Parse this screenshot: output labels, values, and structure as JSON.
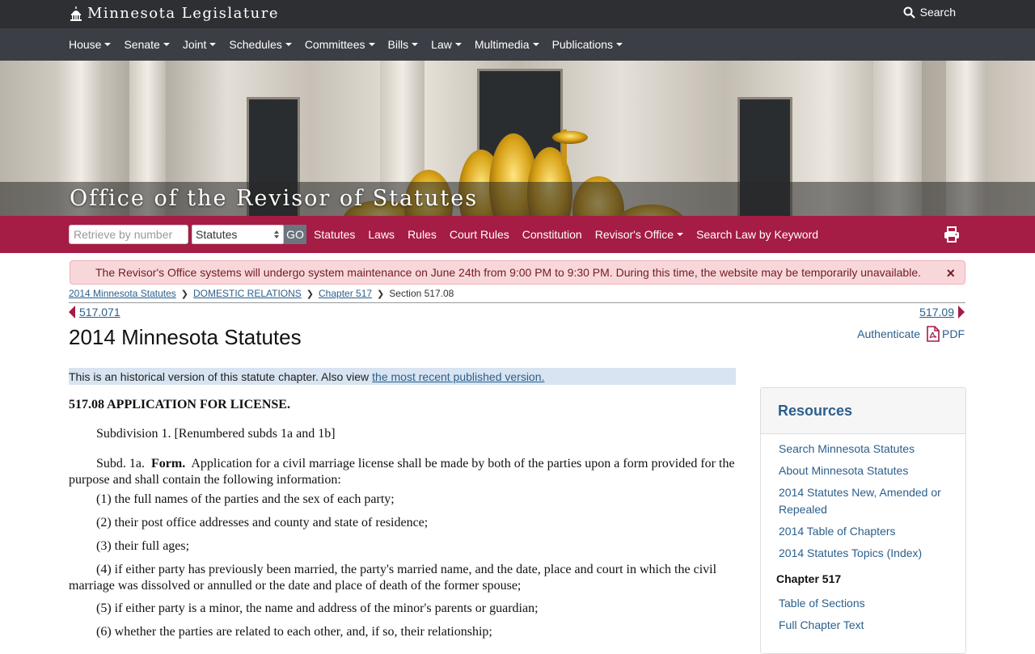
{
  "header": {
    "site_title": "Minnesota Legislature",
    "search_label": "Search"
  },
  "nav": {
    "items": [
      "House",
      "Senate",
      "Joint",
      "Schedules",
      "Committees",
      "Bills",
      "Law",
      "Multimedia",
      "Publications"
    ]
  },
  "hero": {
    "title": "Office of the Revisor of Statutes"
  },
  "toolbar": {
    "retrieve_placeholder": "Retrieve by number",
    "select_value": "Statutes",
    "go_label": "GO",
    "links": [
      "Statutes",
      "Laws",
      "Rules",
      "Court Rules",
      "Constitution",
      "Revisor's Office",
      "Search Law by Keyword"
    ]
  },
  "alert": {
    "text": "The Revisor's Office systems will undergo system maintenance on June 24th from 9:00 PM to 9:30 PM. During this time, the website may be temporarily unavailable.",
    "close": "×"
  },
  "breadcrumb": {
    "items": [
      "2014 Minnesota Statutes",
      "DOMESTIC RELATIONS",
      "Chapter 517"
    ],
    "current": "Section 517.08"
  },
  "pager": {
    "prev": "517.071",
    "next": "517.09"
  },
  "page": {
    "title": "2014 Minnesota Statutes",
    "authenticate": "Authenticate",
    "pdf": "PDF"
  },
  "historical": {
    "text": "This is an historical version of this statute chapter. Also view",
    "link": "the most recent published version."
  },
  "statute": {
    "heading": "517.08 APPLICATION FOR LICENSE.",
    "subd1": "Subdivision 1. [Renumbered subds 1a and 1b]",
    "subd1a_label": "Subd. 1a.",
    "subd1a_title": "Form.",
    "subd1a_text": "Application for a civil marriage license shall be made by both of the parties upon a form provided for the purpose and shall contain the following information:",
    "items": [
      "(1) the full names of the parties and the sex of each party;",
      "(2) their post office addresses and county and state of residence;",
      "(3) their full ages;",
      "(4) if either party has previously been married, the party's married name, and the date, place and court in which the civil marriage was dissolved or annulled or the date and place of death of the former spouse;",
      "(5) if either party is a minor, the name and address of the minor's parents or guardian;",
      "(6) whether the parties are related to each other, and, if so, their relationship;"
    ]
  },
  "resources": {
    "heading": "Resources",
    "links": [
      "Search Minnesota Statutes",
      "About Minnesota Statutes",
      "2014 Statutes New, Amended or Repealed",
      "2014 Table of Chapters",
      "2014 Statutes Topics (Index)"
    ],
    "chapter_heading": "Chapter 517",
    "chapter_links": [
      "Table of Sections",
      "Full Chapter Text"
    ]
  },
  "colors": {
    "brand_red": "#a51c44",
    "topbar": "#2d2f33",
    "navbar": "#3b3e44",
    "link": "#2b5f8c",
    "alert_bg": "#f8d7da"
  }
}
